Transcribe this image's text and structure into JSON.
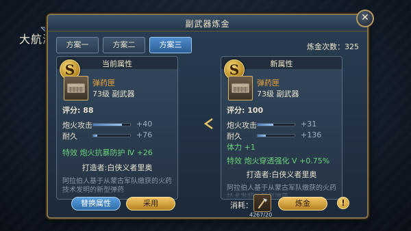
{
  "game": {
    "logo_text": "大航海之路"
  },
  "dialog": {
    "title": "副武器炼金",
    "close_symbol": "✕",
    "refine_count_label": "炼金次数：325",
    "tabs": [
      {
        "label": "方案一",
        "active": false
      },
      {
        "label": "方案二",
        "active": false
      },
      {
        "label": "方案三",
        "active": true
      }
    ],
    "current": {
      "title": "当前属性",
      "grade": "S",
      "item_name": "弹药匣",
      "item_level": "73级 副武器",
      "score": "评分: 88",
      "stats": [
        {
          "label": "炮火攻击",
          "value": "+40",
          "fill": 0.78
        },
        {
          "label": "耐久",
          "value": "+76",
          "fill": 0.12
        }
      ],
      "special": "特效 炮火抗暴防护 Ⅳ +26",
      "maker": "打造者:白侠义者里奥",
      "desc": "阿拉伯人基于从蒙古军队缴获的火药技术发明的新型弹药"
    },
    "new": {
      "title": "新属性",
      "grade": "S",
      "item_name": "弹药匣",
      "item_level": "73级 副武器",
      "score": "评分: 100",
      "stats": [
        {
          "label": "炮火攻击",
          "value": "+31",
          "fill": 0.42
        },
        {
          "label": "耐久",
          "value": "+136",
          "fill": 0.22
        }
      ],
      "extra": "体力 +1",
      "special": "特效 炮火穿透强化 Ⅴ +0.75%",
      "maker": "打造者:白侠义者里奥",
      "desc": "阿拉伯人基于从蒙古军队缴获的火药技术发明的新型弹药"
    },
    "buttons": {
      "replace": "替换属性",
      "adopt": "采用",
      "refine": "炼金"
    },
    "consume": {
      "label": "消耗：",
      "count": "4267/20"
    },
    "warn_symbol": "!",
    "colors": {
      "gold": "#d6b665",
      "orange_name": "#f0a43a",
      "green": "#6cd47a",
      "blue_btn": "#2f6aa8"
    }
  }
}
